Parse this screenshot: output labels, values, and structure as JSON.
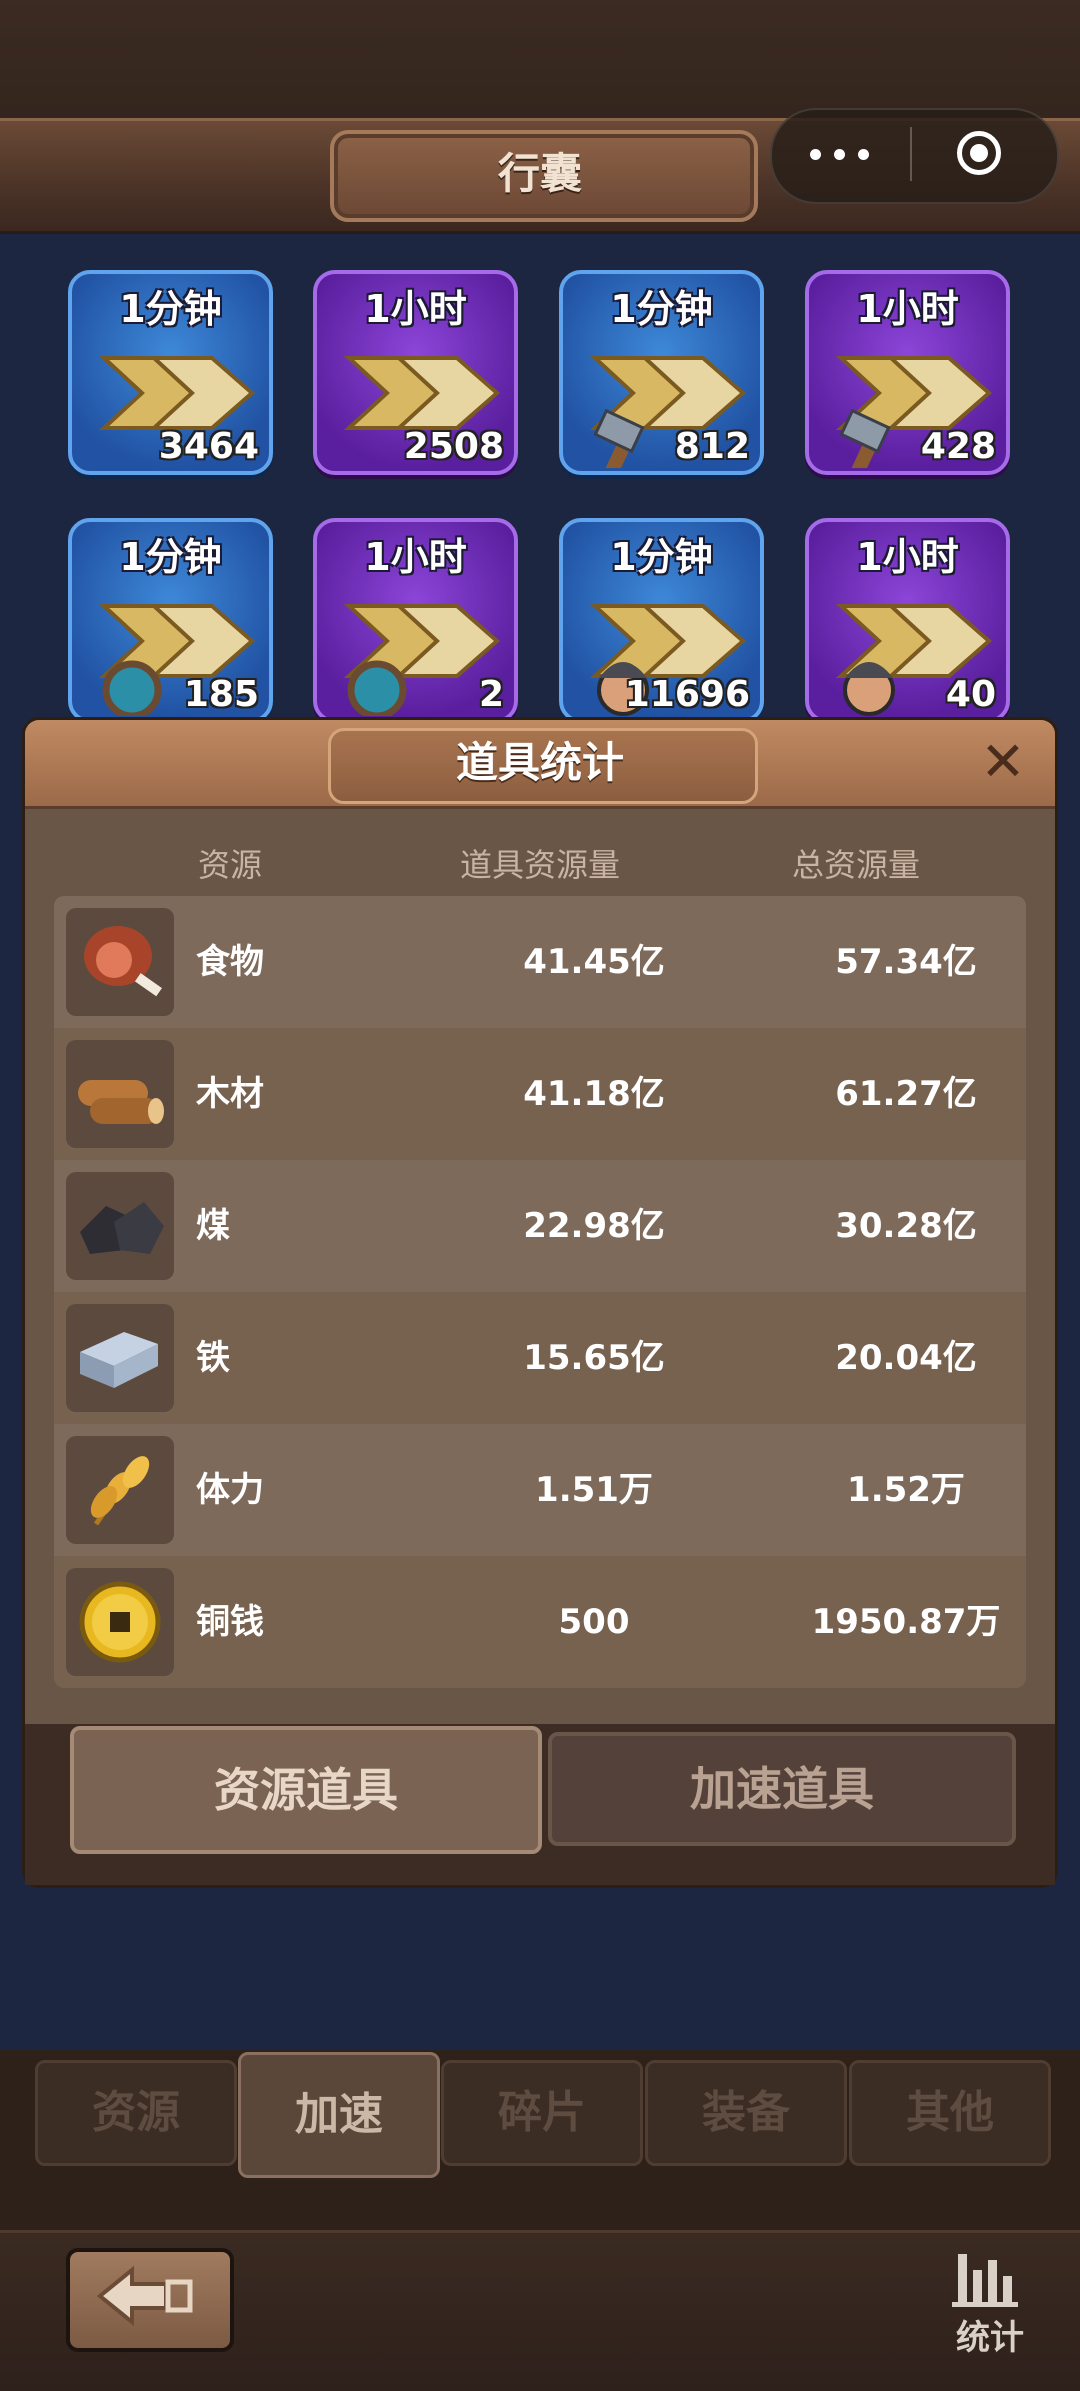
{
  "header": {
    "title": "行囊"
  },
  "items": [
    {
      "label": "1分钟",
      "count": "3464",
      "color": "blue",
      "variant": "arrow"
    },
    {
      "label": "1小时",
      "count": "2508",
      "color": "purple",
      "variant": "arrow"
    },
    {
      "label": "1分钟",
      "count": "812",
      "color": "blue",
      "variant": "hammer"
    },
    {
      "label": "1小时",
      "count": "428",
      "color": "purple",
      "variant": "hammer"
    },
    {
      "label": "1分钟",
      "count": "185",
      "color": "blue",
      "variant": "orb"
    },
    {
      "label": "1小时",
      "count": "2",
      "color": "purple",
      "variant": "orb"
    },
    {
      "label": "1分钟",
      "count": "11696",
      "color": "blue",
      "variant": "soldier"
    },
    {
      "label": "1小时",
      "count": "40",
      "color": "purple",
      "variant": "soldier"
    }
  ],
  "modal": {
    "title": "道具统计",
    "close_icon": "close-icon",
    "columns": [
      "资源",
      "道具资源量",
      "总资源量"
    ],
    "rows": [
      {
        "name": "食物",
        "item": "41.45亿",
        "total": "57.34亿",
        "icon": "meat-icon"
      },
      {
        "name": "木材",
        "item": "41.18亿",
        "total": "61.27亿",
        "icon": "wood-icon"
      },
      {
        "name": "煤",
        "item": "22.98亿",
        "total": "30.28亿",
        "icon": "coal-icon"
      },
      {
        "name": "铁",
        "item": "15.65亿",
        "total": "20.04亿",
        "icon": "iron-icon"
      },
      {
        "name": "体力",
        "item": "1.51万",
        "total": "1.52万",
        "icon": "wheat-icon"
      },
      {
        "name": "铜钱",
        "item": "500",
        "total": "1950.87万",
        "icon": "coin-icon"
      }
    ],
    "tabs": {
      "resource": "资源道具",
      "speedup": "加速道具"
    }
  },
  "bottom_tabs": [
    "资源",
    "加速",
    "碎片",
    "装备",
    "其他"
  ],
  "active_tab": "加速",
  "stats_label": "统计"
}
